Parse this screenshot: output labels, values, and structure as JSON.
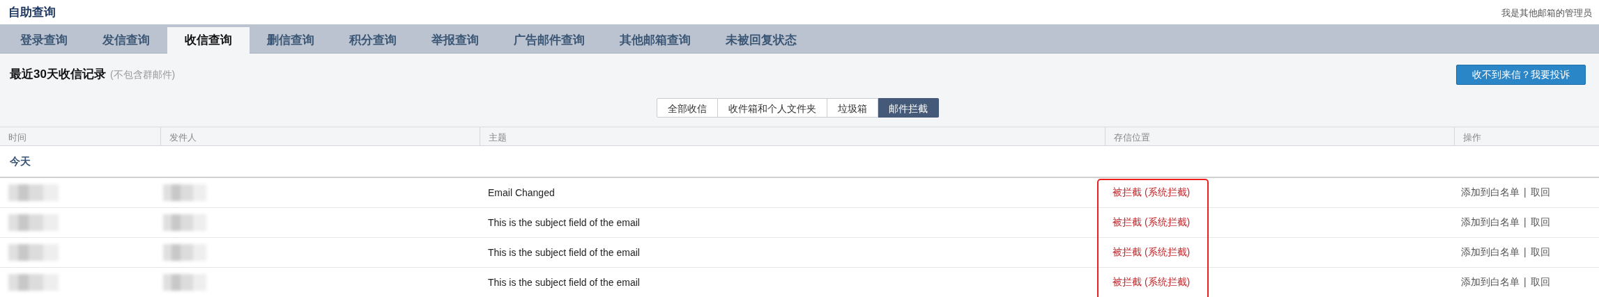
{
  "title": "自助查询",
  "admin_link": "我是其他邮箱的管理员",
  "tabs": [
    {
      "label": "登录查询",
      "selected": false
    },
    {
      "label": "发信查询",
      "selected": false
    },
    {
      "label": "收信查询",
      "selected": true
    },
    {
      "label": "删信查询",
      "selected": false
    },
    {
      "label": "积分查询",
      "selected": false
    },
    {
      "label": "举报查询",
      "selected": false
    },
    {
      "label": "广告邮件查询",
      "selected": false
    },
    {
      "label": "其他邮箱查询",
      "selected": false
    },
    {
      "label": "未被回复状态",
      "selected": false
    }
  ],
  "section": {
    "title": "最近30天收信记录",
    "note": "(不包含群邮件)",
    "complain_button": "收不到来信？我要投诉"
  },
  "filters": [
    {
      "label": "全部收信",
      "selected": false
    },
    {
      "label": "收件箱和个人文件夹",
      "selected": false
    },
    {
      "label": "垃圾箱",
      "selected": false
    },
    {
      "label": "邮件拦截",
      "selected": true
    }
  ],
  "table": {
    "columns": [
      "时间",
      "发件人",
      "主题",
      "存信位置",
      "操作"
    ],
    "groups": [
      {
        "label": "今天",
        "rows": [
          {
            "subject": "Email Changed",
            "location": "被拦截 (系统拦截)",
            "actions": [
              "添加到白名单",
              "取回"
            ],
            "separator": "|"
          },
          {
            "subject": "This is the subject field of the email",
            "location": "被拦截 (系统拦截)",
            "actions": [
              "添加到白名单",
              "取回"
            ],
            "separator": "|"
          },
          {
            "subject": "This is the subject field of the email",
            "location": "被拦截 (系统拦截)",
            "actions": [
              "添加到白名单",
              "取回"
            ],
            "separator": "|"
          },
          {
            "subject": "This is the subject field of the email",
            "location": "被拦截 (系统拦截)",
            "actions": [
              "添加到白名单",
              "取回"
            ],
            "separator": "|"
          }
        ]
      }
    ]
  }
}
